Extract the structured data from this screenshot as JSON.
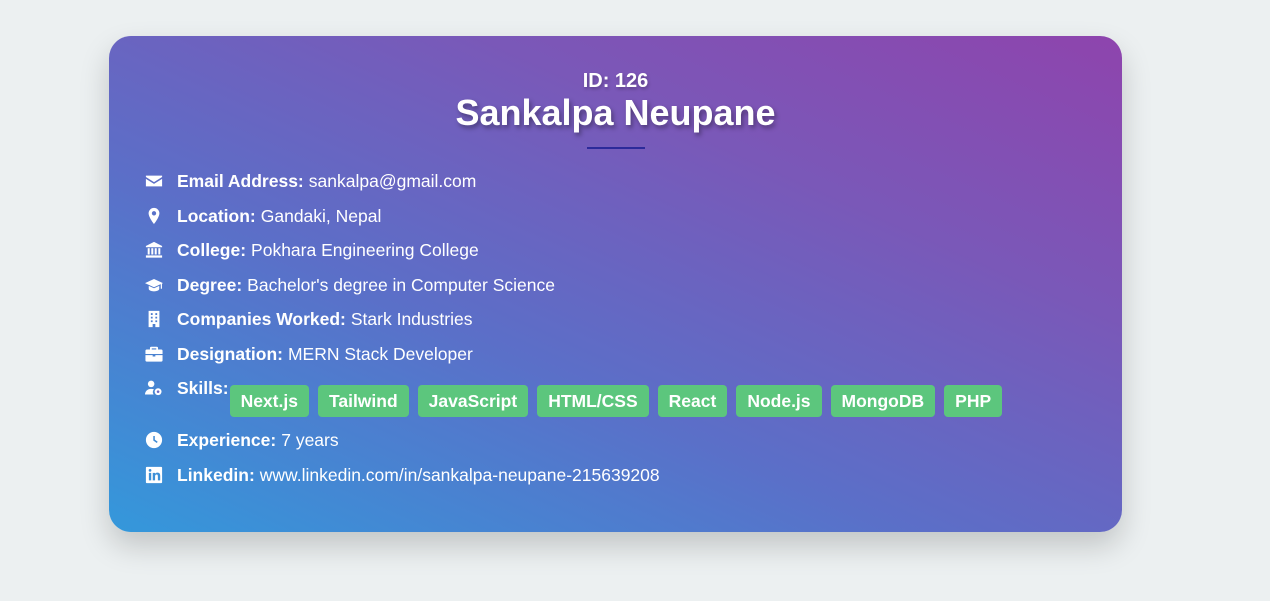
{
  "profile": {
    "id_label": "ID: 126",
    "name": "Sankalpa Neupane"
  },
  "fields": {
    "email": {
      "label": "Email Address:",
      "value": "sankalpa@gmail.com",
      "icon": "envelope-icon"
    },
    "location": {
      "label": "Location:",
      "value": "Gandaki, Nepal",
      "icon": "map-pin-icon"
    },
    "college": {
      "label": "College:",
      "value": "Pokhara Engineering College",
      "icon": "building-columns-icon"
    },
    "degree": {
      "label": "Degree:",
      "value": "Bachelor's degree in Computer Science",
      "icon": "graduation-cap-icon"
    },
    "companies": {
      "label": "Companies Worked:",
      "value": "Stark Industries",
      "icon": "office-building-icon"
    },
    "designation": {
      "label": "Designation:",
      "value": "MERN Stack Developer",
      "icon": "briefcase-icon"
    },
    "skills": {
      "label": "Skills:",
      "icon": "user-gear-icon",
      "items": [
        "Next.js",
        "Tailwind",
        "JavaScript",
        "HTML/CSS",
        "React",
        "Node.js",
        "MongoDB",
        "PHP"
      ]
    },
    "experience": {
      "label": "Experience:",
      "value": "7 years",
      "icon": "clock-icon"
    },
    "linkedin": {
      "label": "Linkedin:",
      "value": "www.linkedin.com/in/sankalpa-neupane-215639208",
      "icon": "linkedin-icon"
    }
  },
  "colors": {
    "background": "#ecf0f1",
    "gradient_start": "#3498db",
    "gradient_end": "#8e44ad",
    "skill_badge": "#5cc67d",
    "title_underline": "#2c2a9a",
    "text": "#ffffff"
  }
}
